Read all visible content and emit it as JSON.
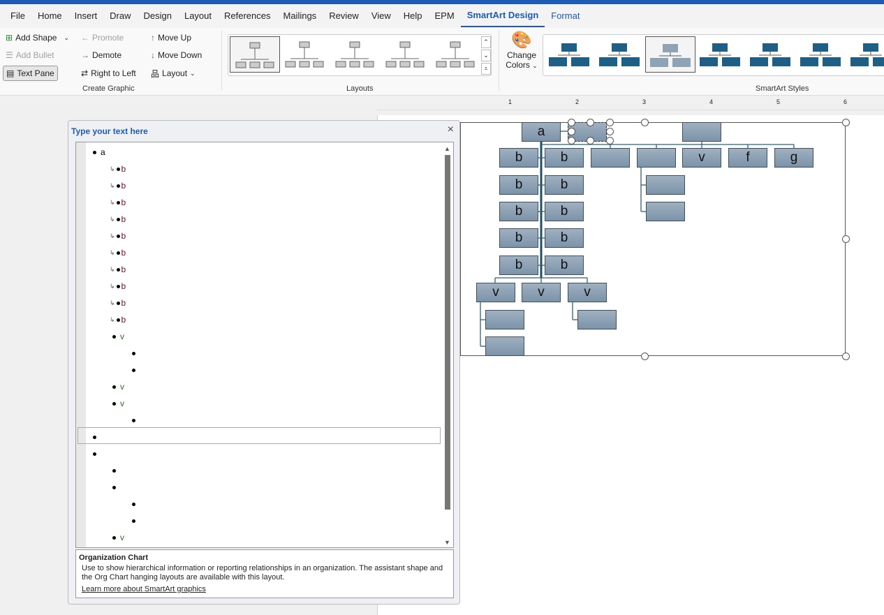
{
  "tabs": [
    "File",
    "Home",
    "Insert",
    "Draw",
    "Design",
    "Layout",
    "References",
    "Mailings",
    "Review",
    "View",
    "Help",
    "EPM",
    "SmartArt Design",
    "Format"
  ],
  "active_tab": "SmartArt Design",
  "create_graphic": {
    "add_shape": "Add Shape",
    "add_bullet": "Add Bullet",
    "text_pane": "Text Pane",
    "promote": "Promote",
    "demote": "Demote",
    "right_to_left": "Right to Left",
    "move_up": "Move Up",
    "move_down": "Move Down",
    "layout": "Layout",
    "group_label": "Create Graphic"
  },
  "layouts": {
    "group_label": "Layouts"
  },
  "change_colors": {
    "line1": "Change",
    "line2": "Colors"
  },
  "smartart_styles": {
    "group_label": "SmartArt Styles"
  },
  "text_pane": {
    "title": "Type your text here",
    "items": [
      {
        "level": 0,
        "text": "a"
      },
      {
        "level": 1,
        "text": "b",
        "arrow": true
      },
      {
        "level": 1,
        "text": "b",
        "arrow": true
      },
      {
        "level": 1,
        "text": "b",
        "arrow": true
      },
      {
        "level": 1,
        "text": "b",
        "arrow": true
      },
      {
        "level": 1,
        "text": "b",
        "arrow": true
      },
      {
        "level": 1,
        "text": "b",
        "arrow": true
      },
      {
        "level": 1,
        "text": "b",
        "arrow": true
      },
      {
        "level": 1,
        "text": "b",
        "arrow": true
      },
      {
        "level": 1,
        "text": "b",
        "arrow": true
      },
      {
        "level": 1,
        "text": "b",
        "arrow": true
      },
      {
        "level": 1,
        "text": "v"
      },
      {
        "level": 2,
        "text": ""
      },
      {
        "level": 2,
        "text": ""
      },
      {
        "level": 1,
        "text": "v"
      },
      {
        "level": 1,
        "text": "v"
      },
      {
        "level": 2,
        "text": ""
      },
      {
        "level": 0,
        "text": "",
        "selected": true
      },
      {
        "level": 0,
        "text": ""
      },
      {
        "level": 1,
        "text": ""
      },
      {
        "level": 1,
        "text": ""
      },
      {
        "level": 2,
        "text": ""
      },
      {
        "level": 2,
        "text": ""
      },
      {
        "level": 1,
        "text": "v"
      }
    ],
    "colors": {
      "b": "#6b0f2a",
      "v": "#2b6b2b",
      "a": "#000000"
    },
    "description_title": "Organization Chart",
    "description": "Use to show hierarchical information or reporting relationships in an organization. The assistant shape and the Org Chart hanging layouts are available with this layout.",
    "learn_more": "Learn more about SmartArt graphics"
  },
  "diagram": {
    "nodes": [
      "a",
      "",
      "",
      "b",
      "b",
      "",
      "",
      "v",
      "f",
      "g",
      "b",
      "b",
      "b",
      "b",
      "b",
      "b",
      "b",
      "b",
      "v",
      "v",
      "v",
      "",
      "",
      "",
      "",
      "",
      ""
    ]
  },
  "ruler_ticks": [
    "1",
    "2",
    "3",
    "4",
    "5",
    "6"
  ]
}
